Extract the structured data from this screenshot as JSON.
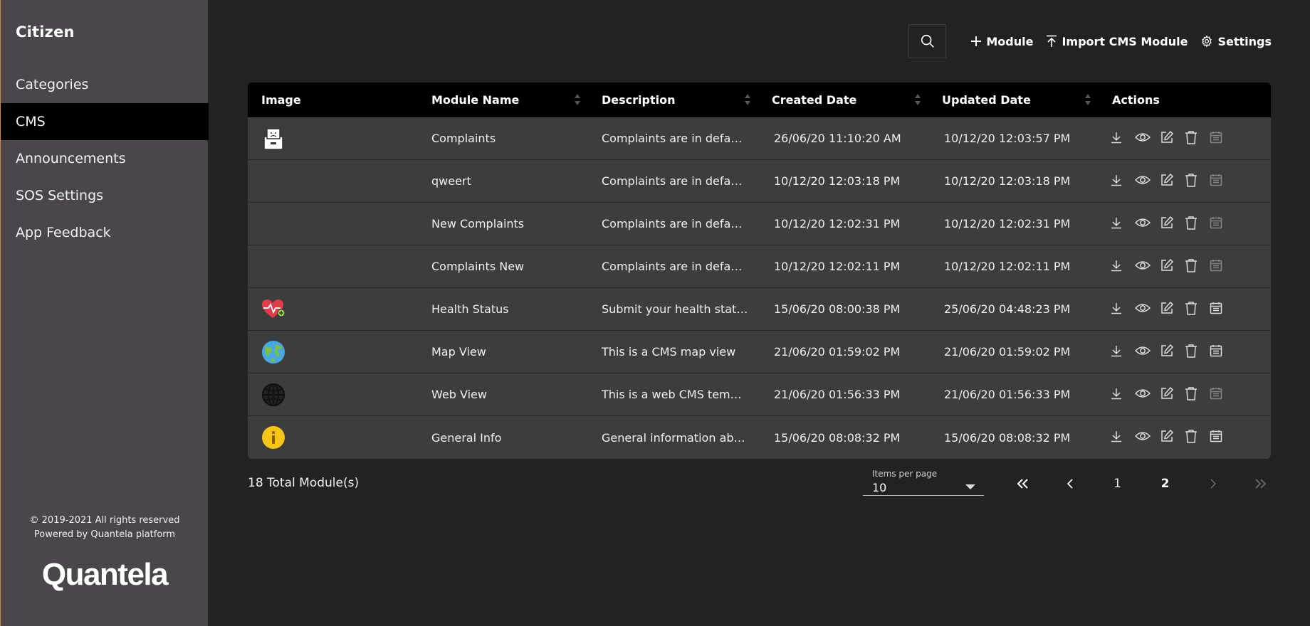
{
  "sidebar": {
    "title": "Citizen",
    "items": [
      {
        "label": "Categories"
      },
      {
        "label": "CMS",
        "active": true
      },
      {
        "label": "Announcements"
      },
      {
        "label": "SOS Settings"
      },
      {
        "label": "App Feedback"
      }
    ],
    "copyright": "© 2019-2021 All rights reserved",
    "powered_by": "Powered by Quantela platform",
    "logo_text": "Quantela"
  },
  "toolbar": {
    "search_icon": "search-icon",
    "module_label": "Module",
    "import_label": "Import CMS Module",
    "settings_label": "Settings"
  },
  "table": {
    "headers": {
      "image": "Image",
      "name": "Module Name",
      "description": "Description",
      "created": "Created Date",
      "updated": "Updated Date",
      "actions": "Actions"
    },
    "rows": [
      {
        "icon": "complaint-box-icon",
        "name": "Complaints",
        "description": "Complaints are in default ...",
        "created": "26/06/20 11:10:20 AM",
        "updated": "10/12/20 12:03:57 PM",
        "last_action_enabled": false
      },
      {
        "icon": "",
        "name": "qweert",
        "description": "Complaints are in default ...",
        "created": "10/12/20 12:03:18 PM",
        "updated": "10/12/20 12:03:18 PM",
        "last_action_enabled": false
      },
      {
        "icon": "",
        "name": "New Complaints",
        "description": "Complaints are in default ...",
        "created": "10/12/20 12:02:31 PM",
        "updated": "10/12/20 12:02:31 PM",
        "last_action_enabled": false
      },
      {
        "icon": "",
        "name": "Complaints New",
        "description": "Complaints are in default ...",
        "created": "10/12/20 12:02:11 PM",
        "updated": "10/12/20 12:02:11 PM",
        "last_action_enabled": false
      },
      {
        "icon": "health-heart-icon",
        "name": "Health Status",
        "description": "Submit your health status ...",
        "created": "15/06/20 08:00:38 PM",
        "updated": "25/06/20 04:48:23 PM",
        "last_action_enabled": true
      },
      {
        "icon": "earth-globe-icon",
        "name": "Map View",
        "description": "This is a CMS map view",
        "created": "21/06/20 01:59:02 PM",
        "updated": "21/06/20 01:59:02 PM",
        "last_action_enabled": true
      },
      {
        "icon": "web-globe-icon",
        "name": "Web View",
        "description": "This is a web CMS template ...",
        "created": "21/06/20 01:56:33 PM",
        "updated": "21/06/20 01:56:33 PM",
        "last_action_enabled": false
      },
      {
        "icon": "info-icon",
        "name": "General Info",
        "description": "General information about ...",
        "created": "15/06/20 08:08:32 PM",
        "updated": "15/06/20 08:08:32 PM",
        "last_action_enabled": true
      }
    ]
  },
  "footer": {
    "total": "18 Total Module(s)",
    "items_per_page_label": "Items per page",
    "items_per_page_value": "10",
    "pages": [
      "1",
      "2"
    ]
  },
  "colors": {
    "sidebar_bg": "#4a464c",
    "page_bg": "#222222",
    "table_bg": "#3d3d3d",
    "header_bg": "#000000",
    "active_nav_bg": "#000000"
  }
}
